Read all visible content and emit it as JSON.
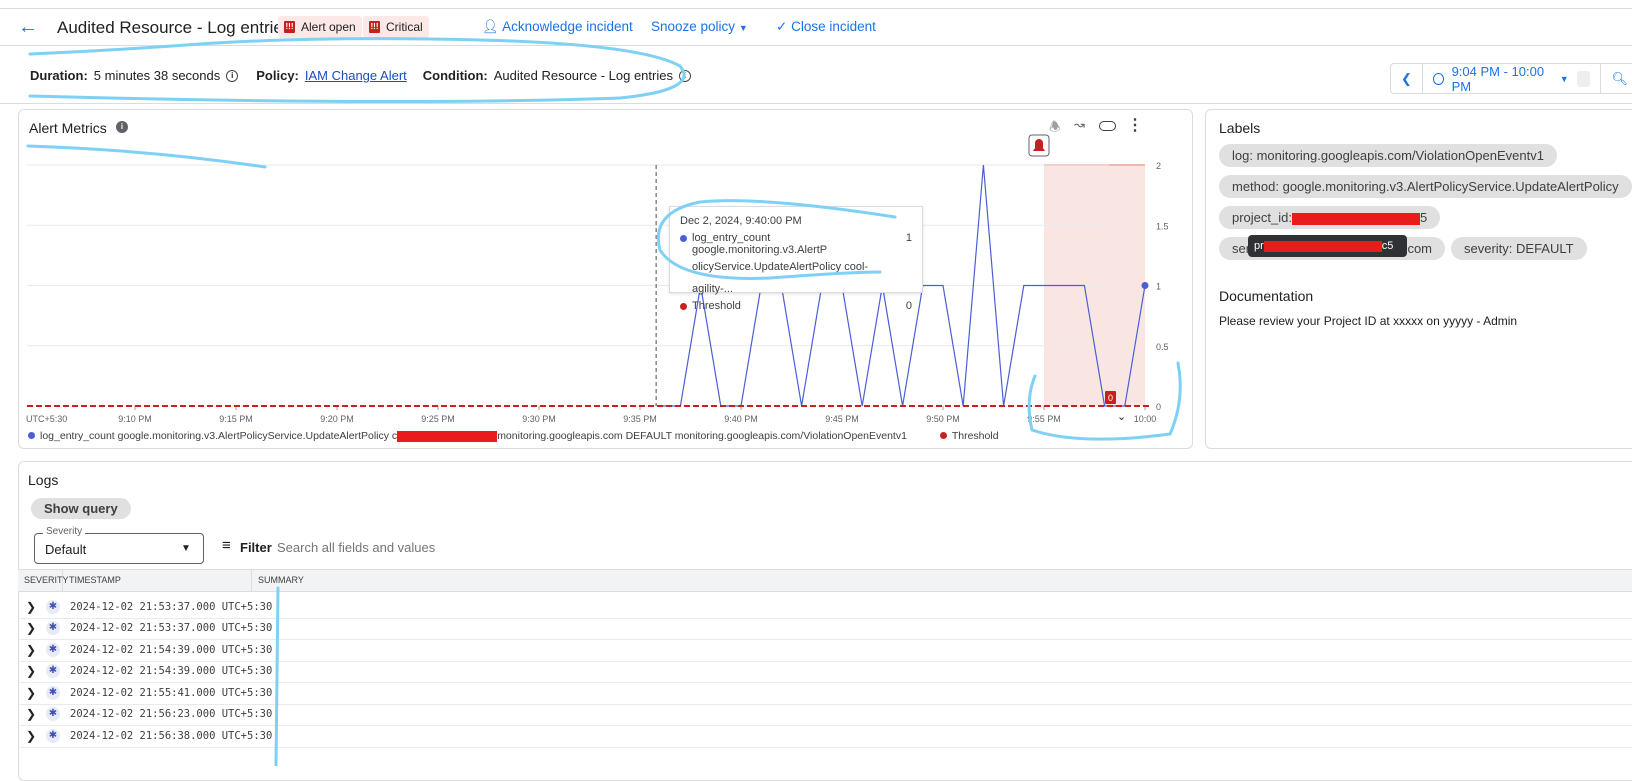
{
  "header": {
    "title": "Audited Resource - Log entries",
    "badges": [
      "Alert open",
      "Critical"
    ],
    "actions": {
      "acknowledge": "Acknowledge incident",
      "snooze": "Snooze policy",
      "close": "Close incident"
    }
  },
  "meta": {
    "duration_label": "Duration:",
    "duration": "5 minutes 38 seconds",
    "policy_label": "Policy:",
    "policy": "IAM Change Alert",
    "condition_label": "Condition:",
    "condition": "Audited Resource - Log entries"
  },
  "time_range": {
    "label": "9:04 PM - 10:00 PM"
  },
  "alert_metrics": {
    "title": "Alert Metrics",
    "timezone": "UTC+5:30",
    "tooltip": {
      "time": "Dec 2, 2024, 9:40:00 PM",
      "series_line1": "log_entry_count google.monitoring.v3.AlertP",
      "series_line2": "olicyService.UpdateAlertPolicy cool-agility-...",
      "series_value": "1",
      "threshold_label": "Threshold",
      "threshold_value": "0"
    },
    "legend": {
      "series_prefix": "log_entry_count google.monitoring.v3.AlertPolicyService.UpdateAlertPolicy c",
      "series_suffix": "monitoring.googleapis.com DEFAULT monitoring.googleapis.com/ViolationOpenEventv1",
      "threshold": "Threshold"
    },
    "threshold_badge": "0"
  },
  "chart_data": {
    "type": "line",
    "x_ticks": [
      "9:10 PM",
      "9:15 PM",
      "9:20 PM",
      "9:25 PM",
      "9:30 PM",
      "9:35 PM",
      "9:40 PM",
      "9:45 PM",
      "9:50 PM",
      "9:55 PM",
      "10:00"
    ],
    "y_ticks": [
      "0",
      "0.5",
      "1",
      "1.5",
      "2"
    ],
    "ylim": [
      0,
      2
    ],
    "xlim": [
      "9:04 PM",
      "10:00 PM"
    ],
    "grid": true,
    "legend_placement": "bottom",
    "series": [
      {
        "name": "log_entry_count",
        "color": "#4a5fd6",
        "x": [
          "9:36",
          "9:37",
          "9:38",
          "9:39",
          "9:40",
          "9:41",
          "9:42",
          "9:43",
          "9:44",
          "9:45",
          "9:46",
          "9:47",
          "9:48",
          "9:49",
          "9:50",
          "9:51",
          "9:52",
          "9:53",
          "9:54",
          "9:55",
          "9:56",
          "9:57",
          "9:58",
          "9:59",
          "10:00"
        ],
        "values": [
          0,
          0,
          1,
          0,
          0,
          1,
          1,
          0,
          1,
          1,
          0,
          1,
          0,
          1,
          1,
          0,
          2,
          0,
          1,
          1,
          1,
          1,
          0,
          0,
          1
        ]
      }
    ],
    "threshold": {
      "name": "Threshold",
      "value": 0,
      "color": "#c5221f"
    },
    "incident_region": [
      "9:55",
      "10:00"
    ],
    "cursor_time": "9:35"
  },
  "labels": {
    "title": "Labels",
    "items": [
      "log: monitoring.googleapis.com/ViolationOpenEventv1",
      "method: google.monitoring.v3.AlertPolicyService.UpdateAlertPolicy",
      "project_id:",
      "ser",
      "severity: DEFAULT"
    ],
    "project_suffix": "5",
    "service_suffix": "com",
    "tooltip_prefix": "pr",
    "tooltip_suffix": "c5"
  },
  "documentation": {
    "title": "Documentation",
    "text": "Please review your Project ID at xxxxx on yyyyy - Admin"
  },
  "logs": {
    "title": "Logs",
    "show_query": "Show query",
    "severity_label": "Severity",
    "severity_value": "Default",
    "filter_label": "Filter",
    "search_placeholder": "Search all fields and values",
    "columns": [
      "SEVERITY",
      "TIMESTAMP",
      "SUMMARY"
    ],
    "rows": [
      "2024-12-02 21:53:37.000 UTC+5:30",
      "2024-12-02 21:53:37.000 UTC+5:30",
      "2024-12-02 21:54:39.000 UTC+5:30",
      "2024-12-02 21:54:39.000 UTC+5:30",
      "2024-12-02 21:55:41.000 UTC+5:30",
      "2024-12-02 21:56:23.000 UTC+5:30",
      "2024-12-02 21:56:38.000 UTC+5:30"
    ]
  },
  "colors": {
    "accent": "#1a73e8",
    "alert_bg": "#fce8e6",
    "critical": "#c5221f",
    "series": "#4a5fd6",
    "annotation": "#7fd0f5"
  }
}
